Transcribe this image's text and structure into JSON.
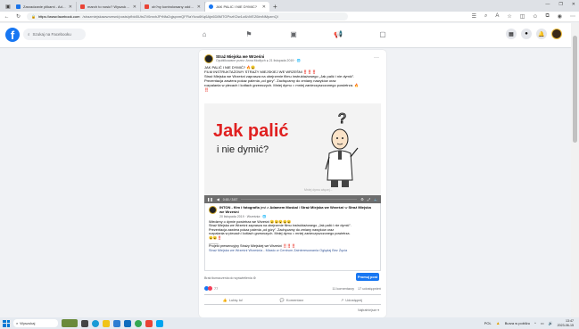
{
  "browser": {
    "tabs": [
      {
        "title": "Zarzadzanie plikami - Adam Kowa",
        "color": "#1a73e8",
        "active": false
      },
      {
        "title": "march to nosic? Wyszukiwanie",
        "color": "#ea4335",
        "active": false
      },
      {
        "title": "ob?ny kontrolowany oddzial",
        "color": "#ea4335",
        "active": false
      },
      {
        "title": "JAK PALIC I NIE DYMIC?",
        "color": "#1877f2",
        "active": true
      }
    ],
    "new_tab": "+",
    "window_controls": [
      "—",
      "❐",
      "✕"
    ],
    "url_host": "https://www.facebook.com",
    "url_rest": "/strazmiejskawwrzesni/posts/pfbid0UtnZV6mxhJPrNfa2qjspxmQFFiaYkvu6Kq6Ajn6D8MTGPxzKDw1zAhiVEZ6imNMpzmQl"
  },
  "facebook": {
    "logo": "f",
    "search_placeholder": "Szukaj na Facebooku",
    "nav_icons": [
      "home-icon",
      "flag-icon",
      "video-icon",
      "megaphone-icon",
      "gaming-icon"
    ]
  },
  "post": {
    "page_name": "Straż Miejska we Wrześni",
    "meta": "Opublikowane przez: Anna Modlych ● 21 listopada 2019 · 🌐",
    "text_lines": [
      "JAK PALIĆ I NIE DYMIĆ? 🔥😮",
      "FILM INSTRUKTAŻOWY STRAŻY MIEJSKIEJ WE WRZEŚNI ‼️‼️‼️",
      "Straż Miejska we Wrześni zaprasza na obejrzenie filmu instruktażowego „Jak palić i nie dymić”.",
      "Prezentacja zawiera pokaz palenia „od góry”. Zachęcamy do zmiany nawyków oraz",
      "rozpalania w piecach i kotłach grzewczych. Mniej dymu = mniej zanieczyszczonego powietrza. 🔥",
      "‼️"
    ],
    "video": {
      "title_big": "Jak palić",
      "title_small": "i nie dymić?",
      "watermark": "Mniej dymu więcej...",
      "time": "0:00 / 3:57"
    },
    "shared": {
      "author": "INTON - film i fotografia",
      "with_text": "jest z",
      "with": "Adamem Moskal",
      "and": "i",
      "in": "Straż Miejska we Wrześni",
      "at": "w",
      "location": "Straż Miejska we Wrześni",
      "meta": "20 listopada 2019 · Września · 🌐",
      "lines": [
        "Wiedzmy o dymie powietrza we Wrześni 😮😮😮😮😮",
        "Straż Miejska we Wrześni zaprasza na obejrzenie filmu instruktażowego „Jak palić i nie dymić”.",
        "Prezentacja zawiera pokaz palenia „od góry”. Zachęcamy do zmiany nawyków oraz",
        "rozpalania w piecach i kotłach grzewczych. Mniej dymu = mniej zanieczyszczonego powietrza.",
        "😮😮‼️",
        "_____",
        "Projekt prewencyjny Straży Miejskiej we Wrześni ‼️‼️‼️"
      ],
      "link": "Straż Miejska we Wrześni Września - Miasto w Centrum Zainteresowania Oglądaj Bez Żęcia"
    },
    "translate": "Brak tłumaczenia do wyświetlenia ⚙",
    "promote": "Promuj post",
    "reaction_count": "77",
    "comments": "11 komentarzy",
    "shares": "17 udostępnień",
    "actions": [
      {
        "icon": "like-icon",
        "label": "Lubię to!"
      },
      {
        "icon": "comment-icon",
        "label": "Komentarz"
      },
      {
        "icon": "share-icon",
        "label": "Udostępnij"
      }
    ],
    "sort": "Najtrafniejsze ▾"
  },
  "taskbar": {
    "search": "Wyszukaj",
    "lang": "POL",
    "weather": "Burza w pobliżu",
    "time": "13:47",
    "date": "2023-06-15"
  },
  "colors": {
    "fb_blue": "#1877f2",
    "accent_red": "#e02020"
  }
}
